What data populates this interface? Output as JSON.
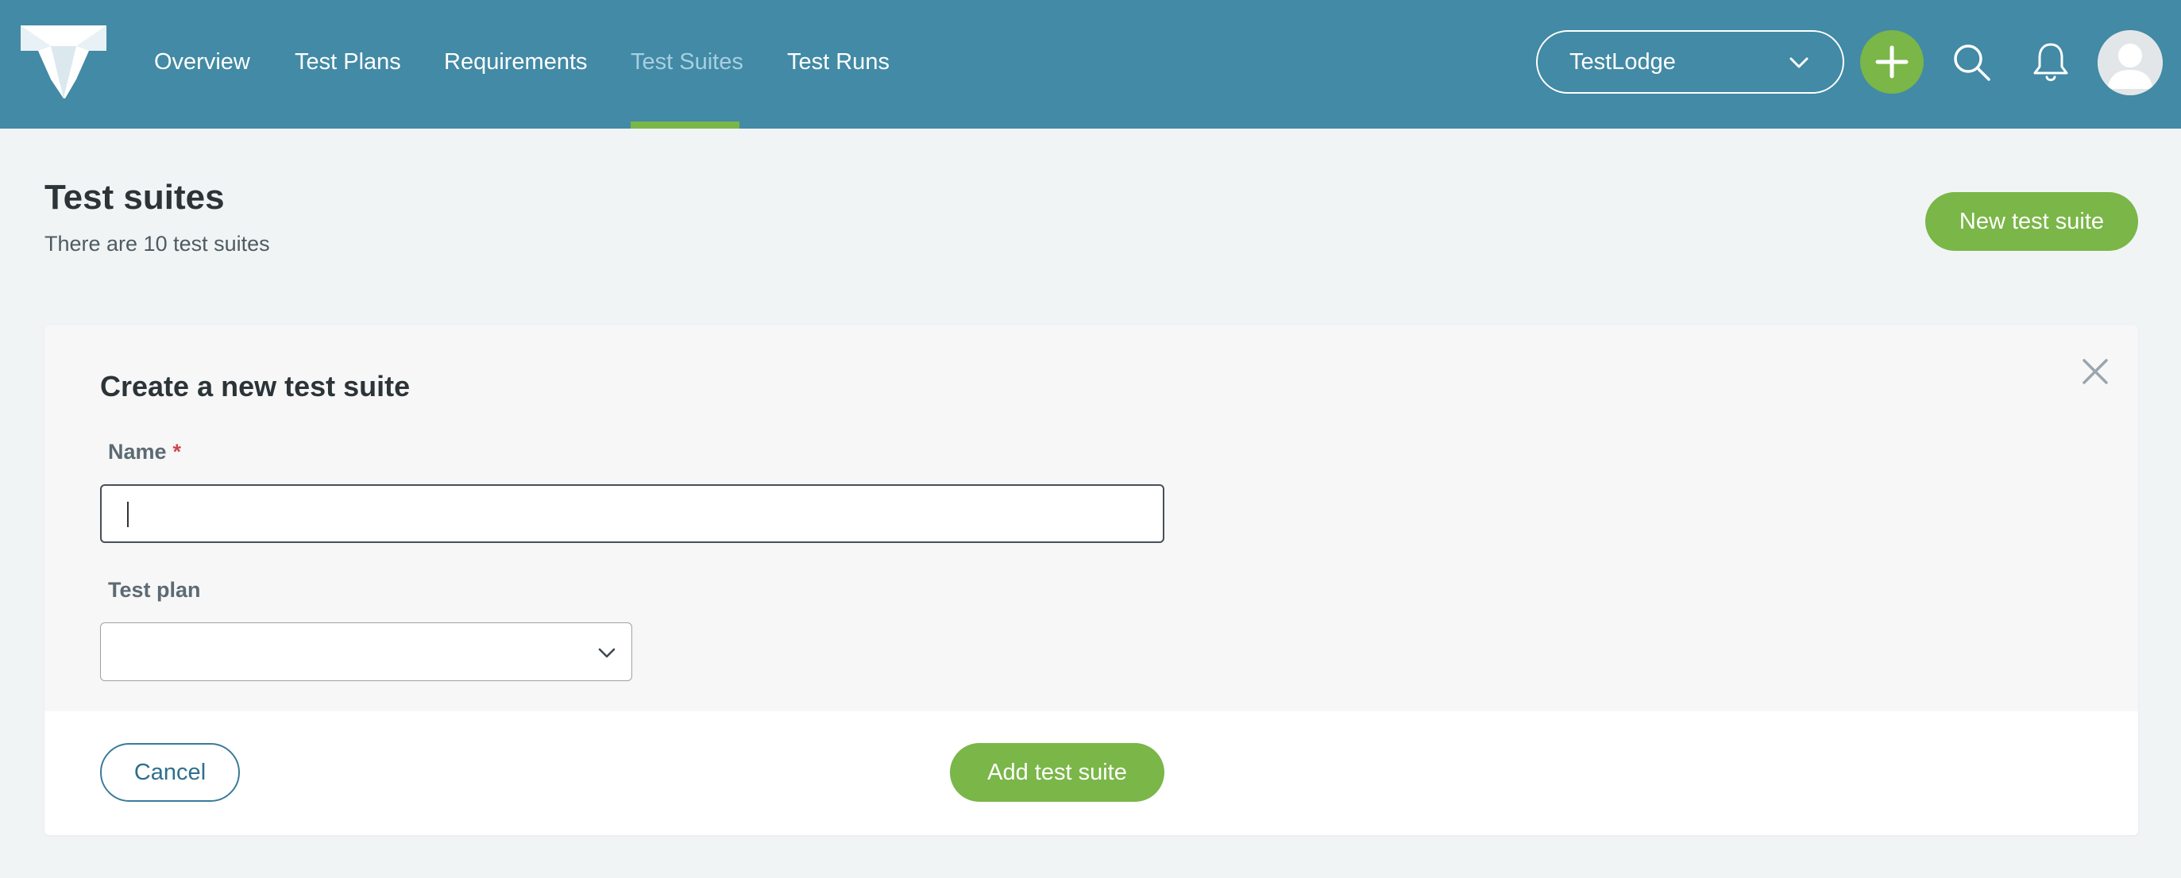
{
  "nav": {
    "logo": "testlodge-logo-icon",
    "items": [
      {
        "label": "Overview",
        "active": false
      },
      {
        "label": "Test Plans",
        "active": false
      },
      {
        "label": "Requirements",
        "active": false
      },
      {
        "label": "Test Suites",
        "active": true
      },
      {
        "label": "Test Runs",
        "active": false
      }
    ],
    "workspace": "TestLodge",
    "icons": {
      "create": "plus-icon",
      "search": "search-icon",
      "notifications": "bell-icon",
      "avatar": "user-avatar-icon"
    },
    "accent_color": "#7ab648",
    "bar_color": "#428aa5"
  },
  "page": {
    "title": "Test suites",
    "subtitle": "There are 10 test suites",
    "new_button": "New test suite"
  },
  "form": {
    "title": "Create a new test suite",
    "name_label": "Name",
    "required_marker": "*",
    "name_value": "",
    "plan_label": "Test plan",
    "plan_value": "",
    "cancel_label": "Cancel",
    "submit_label": "Add test suite"
  }
}
